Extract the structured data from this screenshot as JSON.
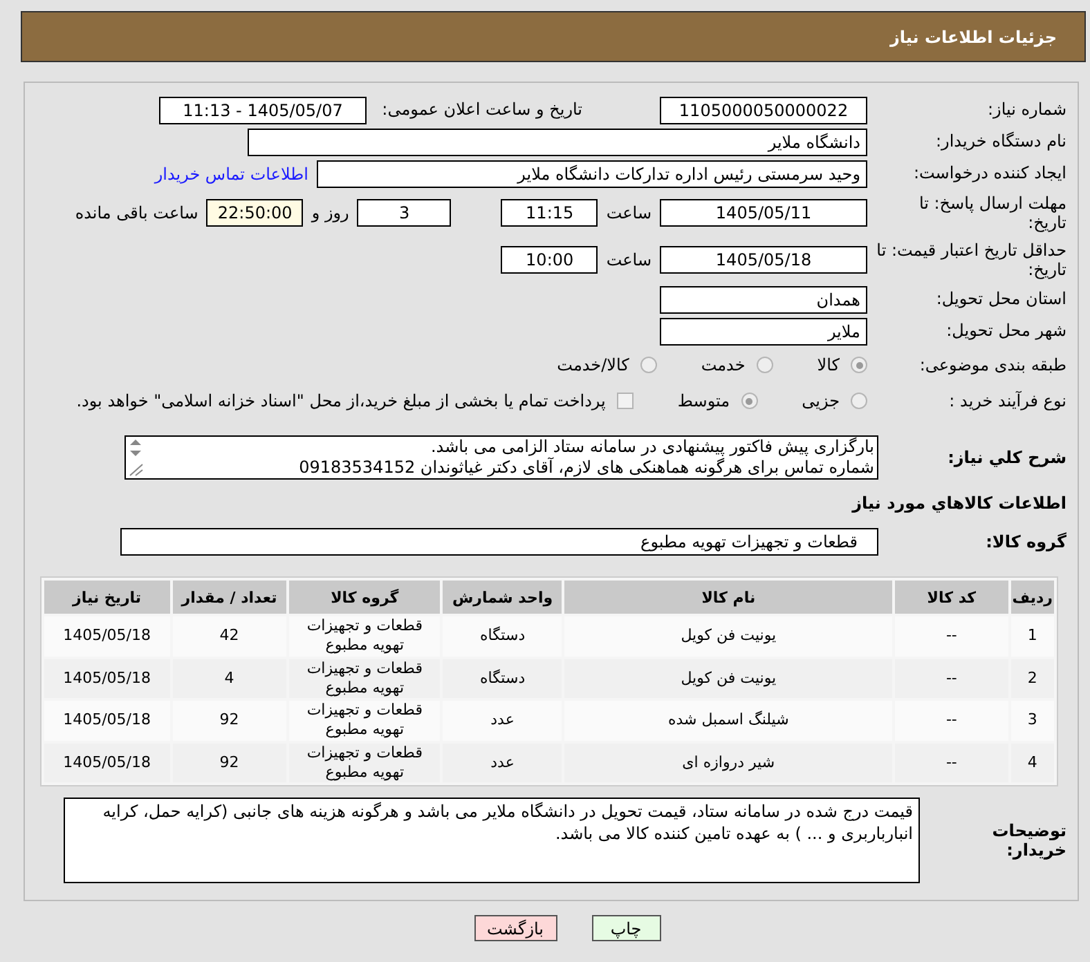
{
  "header": {
    "title": "جزئیات اطلاعات نیاز"
  },
  "fields": {
    "need_number": {
      "label": "شماره نیاز:",
      "value": "1105000050000022"
    },
    "announce": {
      "label": "تاریخ و ساعت اعلان عمومی:",
      "value": "1405/05/07 - 11:13"
    },
    "buyer_org": {
      "label": "نام دستگاه خریدار:",
      "value": "دانشگاه ملایر"
    },
    "requester": {
      "label": "ایجاد کننده درخواست:",
      "value": "وحید سرمستی رئیس اداره تدارکات دانشگاه ملایر",
      "link": "اطلاعات تماس خریدار"
    },
    "deadline": {
      "label": "مهلت ارسال پاسخ: تا تاریخ:",
      "date": "1405/05/11",
      "time_label": "ساعت",
      "time": "11:15",
      "days": "3",
      "days_label": "روز و",
      "remaining": "22:50:00",
      "remaining_label": "ساعت باقی مانده"
    },
    "validity": {
      "label": "حداقل تاریخ اعتبار قیمت: تا تاریخ:",
      "date": "1405/05/18",
      "time_label": "ساعت",
      "time": "10:00"
    },
    "province": {
      "label": "استان محل تحویل:",
      "value": "همدان"
    },
    "city": {
      "label": "شهر محل تحویل:",
      "value": "ملایر"
    }
  },
  "category": {
    "label": "طبقه بندی موضوعی:",
    "options": [
      {
        "label": "کالا",
        "selected": true
      },
      {
        "label": "خدمت",
        "selected": false
      },
      {
        "label": "کالا/خدمت",
        "selected": false
      }
    ]
  },
  "process": {
    "label": "نوع فرآیند خرید :",
    "options": [
      {
        "label": "جزیی",
        "selected": false
      },
      {
        "label": "متوسط",
        "selected": true
      }
    ],
    "treasury": {
      "label": "پرداخت تمام یا بخشی از مبلغ خرید،از محل \"اسناد خزانه اسلامی\" خواهد بود.",
      "checked": false
    }
  },
  "description": {
    "label": "شرح كلي نياز:",
    "lines": [
      "بارگزاری پیش فاکتور پیشنهادی در سامانه ستاد الزامی می باشد.",
      "شماره تماس برای هرگونه هماهنکی های لازم، آقای دکتر غیاثوندان 09183534152"
    ]
  },
  "goods_heading": "اطلاعات كالاهاي مورد نياز",
  "goods_group": {
    "label": "گروه کالا:",
    "value": "قطعات و تجهیزات تهویه مطبوع"
  },
  "table": {
    "columns": [
      "ردیف",
      "کد کالا",
      "نام کالا",
      "واحد شمارش",
      "گروه کالا",
      "تعداد / مقدار",
      "تاریخ نیاز"
    ],
    "rows": [
      [
        "1",
        "--",
        "یونیت فن کویل",
        "دستگاه",
        "قطعات و تجهیزات تهویه مطبوع",
        "42",
        "1405/05/18"
      ],
      [
        "2",
        "--",
        "یونیت فن کویل",
        "دستگاه",
        "قطعات و تجهیزات تهویه مطبوع",
        "4",
        "1405/05/18"
      ],
      [
        "3",
        "--",
        "شیلنگ اسمبل شده",
        "عدد",
        "قطعات و تجهیزات تهویه مطبوع",
        "92",
        "1405/05/18"
      ],
      [
        "4",
        "--",
        "شیر دروازه ای",
        "عدد",
        "قطعات و تجهیزات تهویه مطبوع",
        "92",
        "1405/05/18"
      ]
    ]
  },
  "notes": {
    "label": "توضیحات خریدار:",
    "value": "قیمت درج شده در سامانه ستاد، قیمت تحویل در دانشگاه ملایر می باشد و هرگونه هزینه های جانبی (کرایه حمل، کرایه انبارباربری و ... ) به عهده تامین کننده کالا می باشد."
  },
  "buttons": [
    {
      "label": "چاپ",
      "kind": "print"
    },
    {
      "label": "بازگشت",
      "kind": "back"
    }
  ]
}
